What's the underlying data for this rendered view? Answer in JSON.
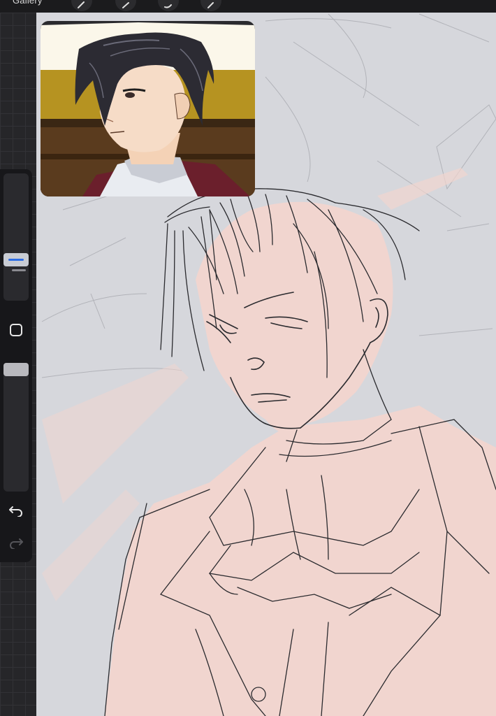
{
  "app": {
    "gallery_label": "Gallery"
  },
  "toolbar": {
    "tools": [
      {
        "name": "actions-wrench-icon"
      },
      {
        "name": "adjustments-wand-icon"
      },
      {
        "name": "selection-s-icon"
      },
      {
        "name": "transform-arrow-icon"
      }
    ]
  },
  "sidebar": {
    "brush_size_level": 0.62,
    "opacity_level": 1.0,
    "undo_icon": "undo-arrow-icon",
    "redo_icon": "redo-arrow-icon",
    "modify_icon": "square-modify-icon"
  },
  "colors": {
    "canvas_bg": "#d6d7dc",
    "skin_fill": "#f1d5cf",
    "sketch_line": "#2a2a2e",
    "accent_blue": "#2d6ee6",
    "sidebar_bg": "#17171a"
  }
}
